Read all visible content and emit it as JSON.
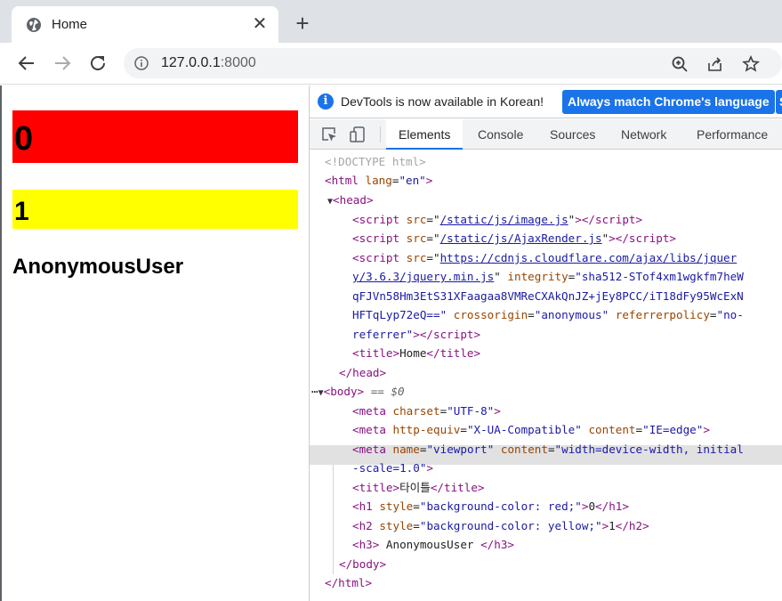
{
  "browser": {
    "tab_title": "Home",
    "url_host": "127.0.0.1",
    "url_port": ":8000"
  },
  "page": {
    "h1": "0",
    "h2": "1",
    "h3": "AnonymousUser"
  },
  "devtools": {
    "infobar_text": "DevTools is now available in Korean!",
    "infobar_button": "Always match Chrome's language",
    "infobar_button2": "S",
    "tabs": [
      "Elements",
      "Console",
      "Sources",
      "Network",
      "Performance"
    ],
    "active_tab": "Elements",
    "body_eq": "== $0",
    "lines": {
      "doctype": "<!DOCTYPE html>",
      "html_open_tag": "<html",
      "html_lang_attr": " lang",
      "html_lang_val": "\"en\"",
      "head_tag": "<head>",
      "script1_src": "/static/js/image.js",
      "script2_src": "/static/js/AjaxRender.js",
      "script3_src_a": "https://cdnjs.cloudflare.com/ajax/libs/jquer",
      "script3_src_b": "y/3.6.3/jquery.min.js",
      "integrity_val_a": "\"sha512-STof4xm1wgkfm7heW",
      "integrity_val_b": "qFJVn58Hm3EtS31XFaagaa8VMReCXAkQnJZ+jEy8PCC/iT18dFy95WcExN",
      "integrity_val_c": "HFTqLyp72eQ==\"",
      "crossorigin_val": "\"anonymous\"",
      "referrerpolicy_val_a": "\"no-",
      "referrerpolicy_val_b": "referrer\"",
      "head_title_text": "Home",
      "meta_charset": "\"UTF-8\"",
      "meta_http_equiv": "\"X-UA-Compatible\"",
      "meta_content_ie": "\"IE=edge\"",
      "meta_name": "\"viewport\"",
      "meta_content_vp_a": "\"width=device-width, initial",
      "meta_content_vp_b": "-scale=1.0\"",
      "body_title_text": "타이틀",
      "h1_style": "\"background-color: red;\"",
      "h1_text": "0",
      "h2_style": "\"background-color: yellow;\"",
      "h2_text": "1",
      "h3_text": " AnonymousUser "
    }
  }
}
